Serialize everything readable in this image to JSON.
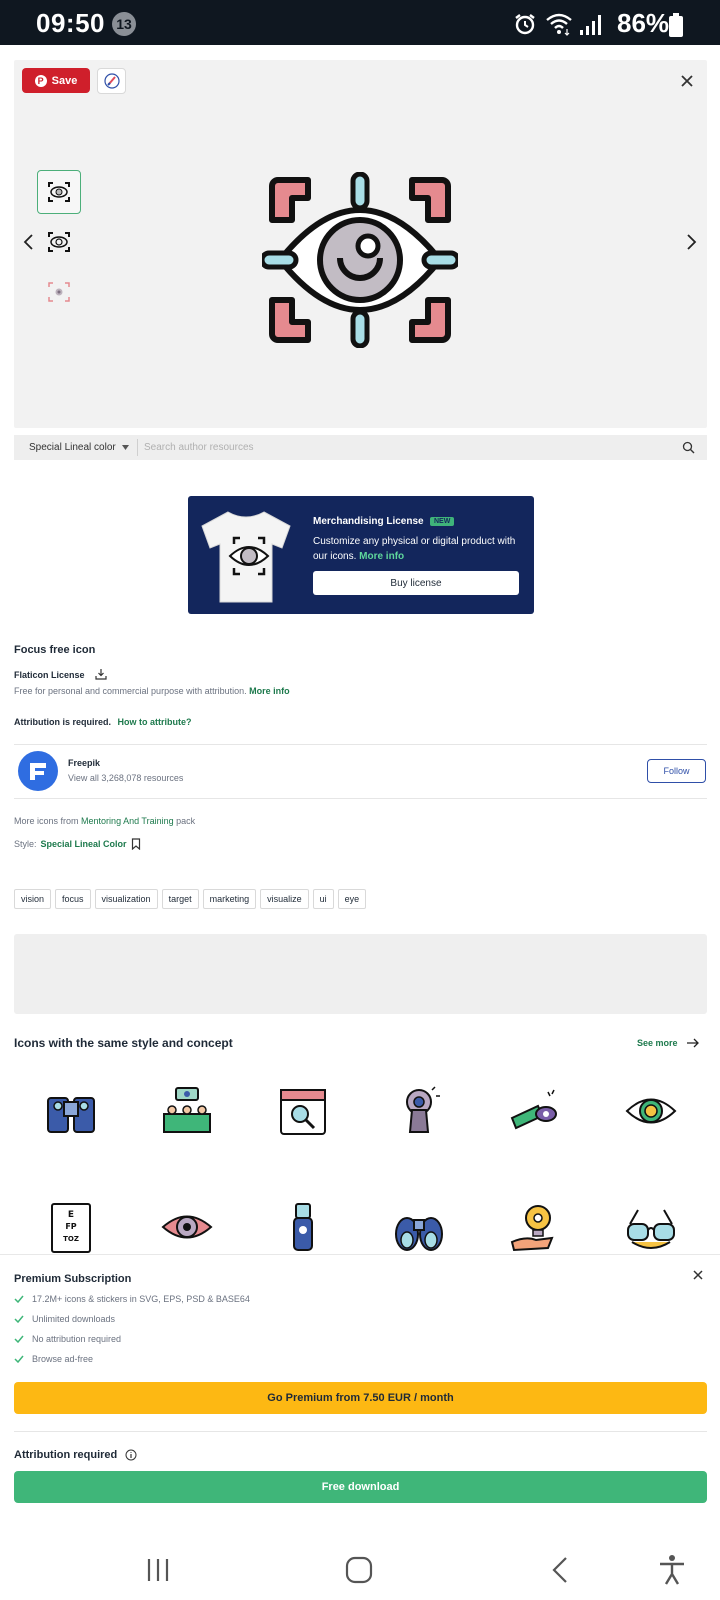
{
  "status_bar": {
    "time": "09:50",
    "notification_count": "13",
    "battery": "86%"
  },
  "preview": {
    "save_label": "Save",
    "pin_glyph": "P",
    "colors": {
      "save_red": "#cf1f2b",
      "selected_border": "#4caf7a"
    }
  },
  "search": {
    "style_label": "Special Lineal color",
    "placeholder": "Search author resources"
  },
  "merch": {
    "title": "Merchandising License",
    "badge": "NEW",
    "desc": "Customize any physical or digital product with our icons.",
    "more": "More info",
    "buy_label": "Buy license"
  },
  "info": {
    "title": "Focus free icon",
    "license_name": "Flaticon License",
    "license_desc": "Free for personal and commercial purpose with attribution.",
    "license_more": "More info",
    "attribution_text": "Attribution is required.",
    "attribution_how": "How to attribute?"
  },
  "author": {
    "name": "Freepik",
    "count": "View all 3,268,078 resources",
    "follow_label": "Follow"
  },
  "pack": {
    "prefix": "More icons from",
    "name": "Mentoring And Training",
    "suffix": "pack",
    "style_prefix": "Style:",
    "style_name": "Special Lineal Color"
  },
  "tags": [
    "vision",
    "focus",
    "visualization",
    "target",
    "marketing",
    "visualize",
    "ui",
    "eye"
  ],
  "related": {
    "title": "Icons with the same style and concept",
    "see_more": "See more",
    "icons": [
      "binoculars-icon",
      "training-group-icon",
      "calendar-search-icon",
      "keyhole-eye-icon",
      "telescope-icon",
      "eye-money-icon",
      "eye-chart-icon",
      "eye-icon",
      "eye-drops-icon",
      "binoculars-icon",
      "idea-hand-icon",
      "glasses-icon"
    ],
    "eye_chart_text": "E FP TOZ"
  },
  "premium": {
    "title": "Premium Subscription",
    "features": [
      "17.2M+ icons & stickers in SVG, EPS, PSD & BASE64",
      "Unlimited downloads",
      "No attribution required",
      "Browse ad-free"
    ],
    "cta": "Go Premium from 7.50 EUR / month",
    "attribution_required": "Attribution required",
    "free_download": "Free download",
    "colors": {
      "premium_yellow": "#fdb813",
      "download_green": "#3fb679"
    }
  }
}
